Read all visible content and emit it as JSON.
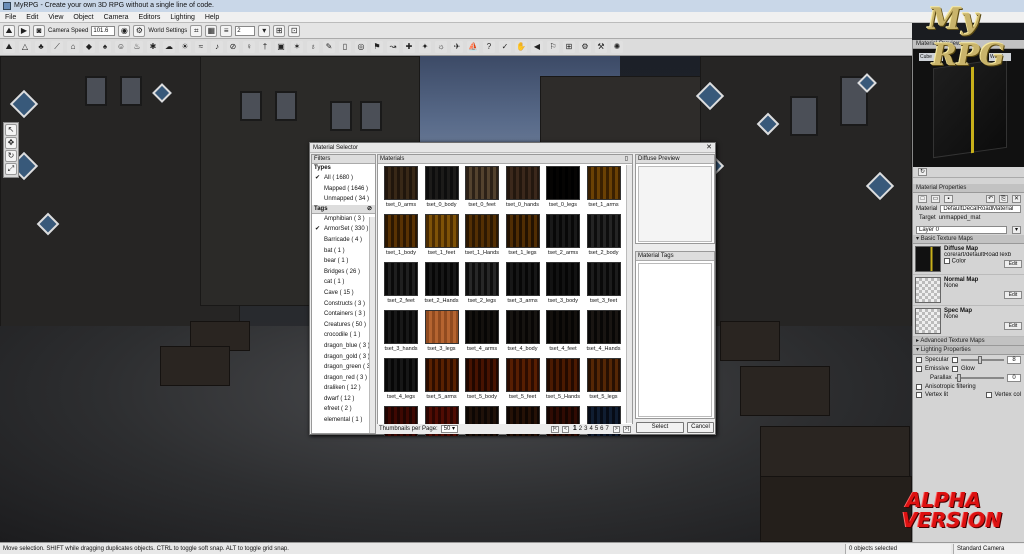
{
  "window": {
    "title": "MyRPG - Create your own 3D RPG without a single line of code."
  },
  "menu": [
    "File",
    "Edit",
    "View",
    "Object",
    "Camera",
    "Editors",
    "Lighting",
    "Help"
  ],
  "toolbar": {
    "camera_speed_label": "Camera Speed",
    "camera_speed_value": "101.6",
    "world_settings_label": "World Settings",
    "grid_value": "2"
  },
  "logo": {
    "line1": "My",
    "line2": "RPG"
  },
  "alpha": {
    "line1": "ALPHA",
    "line2": "VERSION"
  },
  "material_preview": {
    "title": "Material Preview",
    "camera_label": "Cube",
    "world_label": "World"
  },
  "material_properties": {
    "title": "Material Properties",
    "material_label": "Material",
    "material_value": "DefaultDecalRoadMaterial",
    "target_label": "Target",
    "target_value": "unmapped_mat",
    "layer": "Layer 0",
    "basic_section": "Basic Texture Maps",
    "diffuse_label": "Diffuse Map",
    "diffuse_value": "core/art/defaultRoadTexb",
    "color_label": "Color",
    "normal_label": "Normal Map",
    "normal_value": "None",
    "spec_label": "Spec Map",
    "spec_value": "None",
    "edit_label": "Edit",
    "advanced_section": "Advanced Texture Maps",
    "lighting_section": "Lighting Properties",
    "specular_label": "Specular",
    "specular_value": "8",
    "emissive_label": "Emissive",
    "glow_label": "Glow",
    "parallax_label": "Parallax",
    "parallax_value": "0",
    "aniso_label": "Anisotropic filtering",
    "vertex_lit_label": "Vertex lit",
    "vertex_color_label": "Vertex col"
  },
  "dialog": {
    "title": "Material Selector",
    "close": "✕",
    "filters_label": "Filters",
    "types_label": "Types",
    "types": [
      {
        "label": "All ( 1680 )",
        "checked": true
      },
      {
        "label": "Mapped ( 1646 )",
        "checked": false
      },
      {
        "label": "Unmapped ( 34 )",
        "checked": false
      }
    ],
    "tags_label": "Tags",
    "tags": [
      {
        "label": "Amphibian ( 3 )",
        "checked": false
      },
      {
        "label": "ArmorSet ( 330 )",
        "checked": true
      },
      {
        "label": "Barricade ( 4 )",
        "checked": false
      },
      {
        "label": "bat ( 1 )",
        "checked": false
      },
      {
        "label": "bear ( 1 )",
        "checked": false
      },
      {
        "label": "Bridges ( 26 )",
        "checked": false
      },
      {
        "label": "cat ( 1 )",
        "checked": false
      },
      {
        "label": "Cave ( 15 )",
        "checked": false
      },
      {
        "label": "Constructs ( 3 )",
        "checked": false
      },
      {
        "label": "Containers ( 3 )",
        "checked": false
      },
      {
        "label": "Creatures ( 50 )",
        "checked": false
      },
      {
        "label": "crocodile ( 1 )",
        "checked": false
      },
      {
        "label": "dragon_blue ( 3 )",
        "checked": false
      },
      {
        "label": "dragon_gold ( 3 )",
        "checked": false
      },
      {
        "label": "dragon_green ( 3",
        "checked": false
      },
      {
        "label": "dragon_red ( 3 )",
        "checked": false
      },
      {
        "label": "draliken ( 12 )",
        "checked": false
      },
      {
        "label": "dwarf ( 12 )",
        "checked": false
      },
      {
        "label": "efreet ( 2 )",
        "checked": false
      },
      {
        "label": "elemental ( 1 )",
        "checked": false
      }
    ],
    "materials_label": "Materials",
    "materials": [
      {
        "name": "tset_0_arms",
        "c1": "#5a4a38",
        "c2": "#a08a6a"
      },
      {
        "name": "tset_0_body",
        "c1": "#3a3a3a",
        "c2": "#7a7670"
      },
      {
        "name": "tset_0_feet",
        "c1": "#6a5c4c",
        "c2": "#c8b89a"
      },
      {
        "name": "tset_0_hands",
        "c1": "#5e4c3c",
        "c2": "#a08672"
      },
      {
        "name": "tset_0_legs",
        "c1": "#0a0a0a",
        "c2": "#7a6a4c"
      },
      {
        "name": "tset_1_arms",
        "c1": "#7a5a10",
        "c2": "#e0b83a"
      },
      {
        "name": "tset_1_body",
        "c1": "#6a4c10",
        "c2": "#d6a830"
      },
      {
        "name": "tset_1_feet",
        "c1": "#8a6a18",
        "c2": "#e8c44a"
      },
      {
        "name": "tset_1_Hands",
        "c1": "#6a4e14",
        "c2": "#c89a28"
      },
      {
        "name": "tset_1_legs",
        "c1": "#5e4410",
        "c2": "#d8aa34"
      },
      {
        "name": "tset_2_arms",
        "c1": "#2e2e2e",
        "c2": "#8a8a8a"
      },
      {
        "name": "tset_2_body",
        "c1": "#3a3a3a",
        "c2": "#a0a0a0"
      },
      {
        "name": "tset_2_feet",
        "c1": "#333333",
        "c2": "#9a9a9a"
      },
      {
        "name": "tset_2_Hands",
        "c1": "#2a2a2a",
        "c2": "#8c8c8c"
      },
      {
        "name": "tset_2_legs",
        "c1": "#3c3c3c",
        "c2": "#a6a6a6"
      },
      {
        "name": "tset_3_arms",
        "c1": "#2a2a2a",
        "c2": "#8a8a8a"
      },
      {
        "name": "tset_3_body",
        "c1": "#262626",
        "c2": "#7a7a7a"
      },
      {
        "name": "tset_3_feet",
        "c1": "#303030",
        "c2": "#959595"
      },
      {
        "name": "tset_3_hands",
        "c1": "#2e2e2e",
        "c2": "#858585"
      },
      {
        "name": "tset_3_legs",
        "c1": "#c08a5a",
        "c2": "#f0b888"
      },
      {
        "name": "tset_4_arms",
        "c1": "#2a2622",
        "c2": "#7a7068"
      },
      {
        "name": "tset_4_body",
        "c1": "#2c2824",
        "c2": "#827870"
      },
      {
        "name": "tset_4_feet",
        "c1": "#282420",
        "c2": "#766c62"
      },
      {
        "name": "tset_4_Hands",
        "c1": "#2e2a26",
        "c2": "#888078"
      },
      {
        "name": "tset_4_legs",
        "c1": "#2a2a2a",
        "c2": "#8a8a8a"
      },
      {
        "name": "tset_5_arms",
        "c1": "#6a3a08",
        "c2": "#d8902a"
      },
      {
        "name": "tset_5_body",
        "c1": "#5a2a0a",
        "c2": "#c8741e"
      },
      {
        "name": "tset_5_feet",
        "c1": "#6a380c",
        "c2": "#d28a2a"
      },
      {
        "name": "tset_5_Hands",
        "c1": "#5e320a",
        "c2": "#cc8426"
      },
      {
        "name": "tset_5_legs",
        "c1": "#644016",
        "c2": "#d89c3a"
      },
      {
        "name": "",
        "c1": "#5a1e0e",
        "c2": "#b04428"
      },
      {
        "name": "",
        "c1": "#6a2410",
        "c2": "#c0562e"
      },
      {
        "name": "",
        "c1": "#3a2a20",
        "c2": "#8a6a4a"
      },
      {
        "name": "",
        "c1": "#3e2818",
        "c2": "#9a6a40"
      },
      {
        "name": "",
        "c1": "#4a2212",
        "c2": "#a45030"
      },
      {
        "name": "",
        "c1": "#26364a",
        "c2": "#6a8aaa"
      }
    ],
    "thumbs_per_page_label": "Thumbnails per Page:",
    "thumbs_per_page_value": "50",
    "pages": [
      "1",
      "2",
      "3",
      "4",
      "5",
      "6",
      "7"
    ],
    "current_page": "1",
    "pager_first": "|<",
    "pager_prev": "<",
    "pager_next": ">",
    "pager_last": ">|",
    "diffuse_preview_label": "Diffuse Preview",
    "material_tags_label": "Material Tags",
    "select_button": "Select",
    "cancel_button": "Cancel"
  },
  "status": {
    "hint": "Move selection.  SHIFT while dragging duplicates objects.  CTRL to toggle soft snap.  ALT to toggle grid snap.",
    "selected": "0 objects selected",
    "camera": "Standard Camera"
  }
}
